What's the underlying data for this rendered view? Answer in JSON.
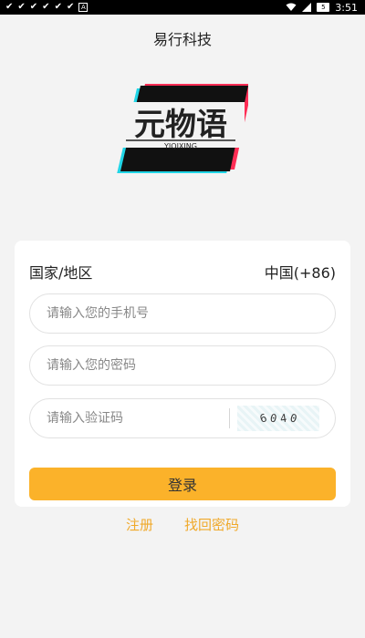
{
  "status_bar": {
    "time": "3:51",
    "battery": "5"
  },
  "app": {
    "title": "易行科技"
  },
  "logo": {
    "text": "元物语",
    "subtitle": "YIQIXING",
    "colors": {
      "bg": "#111111",
      "pink": "#ff2d55",
      "cyan": "#20d5e6"
    }
  },
  "form": {
    "region_label": "国家/地区",
    "region_value": "中国(+86)",
    "phone_placeholder": "请输入您的手机号",
    "password_placeholder": "请输入您的密码",
    "code_placeholder": "请输入验证码",
    "captcha_chars": [
      "6",
      "0",
      "4",
      "0"
    ],
    "login_label": "登录"
  },
  "links": {
    "register": "注册",
    "forgot_password": "找回密码"
  },
  "colors": {
    "accent": "#fbb22a",
    "link": "#f0a92a"
  }
}
